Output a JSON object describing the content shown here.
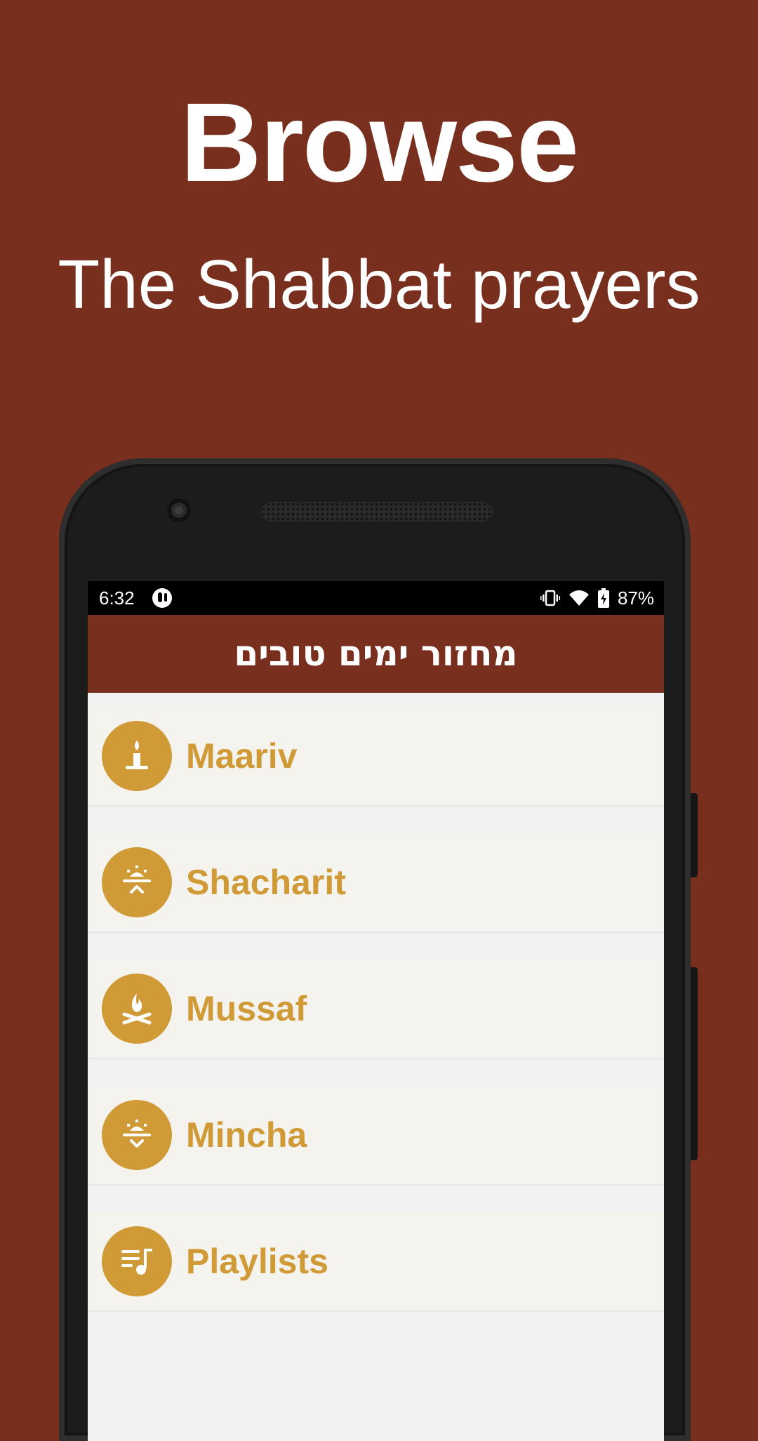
{
  "hero": {
    "title": "Browse",
    "subtitle": "The Shabbat prayers"
  },
  "status_bar": {
    "time": "6:32",
    "battery": "87%"
  },
  "app_bar": {
    "title": "מחזור ימים טובים"
  },
  "menu": {
    "items": [
      {
        "label": "Maariv",
        "icon": "candle-icon"
      },
      {
        "label": "Shacharit",
        "icon": "sunrise-icon"
      },
      {
        "label": "Mussaf",
        "icon": "altar-fire-icon"
      },
      {
        "label": "Mincha",
        "icon": "sunset-icon"
      },
      {
        "label": "Playlists",
        "icon": "playlist-icon"
      }
    ]
  },
  "colors": {
    "background": "#782f1d",
    "accent": "#d09a37",
    "list_item_bg": "#f5f3ed"
  }
}
